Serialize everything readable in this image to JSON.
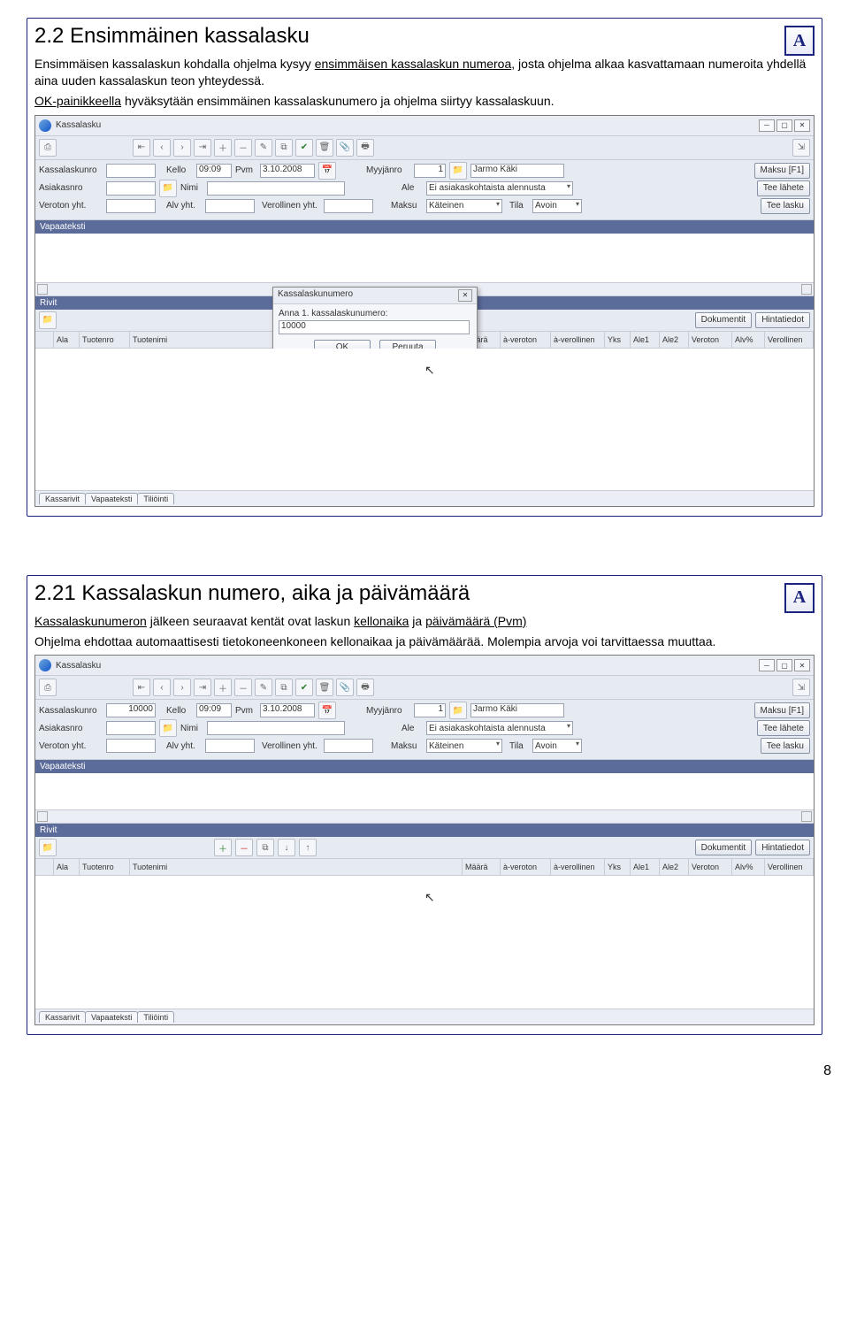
{
  "section1": {
    "heading": "2.2 Ensimmäinen kassalasku",
    "p1a": "Ensimmäisen kassalaskun kohdalla ohjelma kysyy ",
    "p1b": "ensimmäisen kassalaskun numeroa",
    "p1c": ", josta ohjelma alkaa kasvattamaan numeroita yhdellä aina uuden kassalaskun teon yhteydessä.",
    "p2a": "OK-painikkeella",
    "p2b": " hyväksytään ensimmäinen kassalaskunumero ja ohjelma siirtyy kassalaskuun."
  },
  "section2": {
    "heading": "2.21 Kassalaskun numero, aika ja päivämäärä",
    "p1a": "Kassalaskunumeron",
    "p1b": " jälkeen seuraavat kentät ovat laskun ",
    "p1c": "kellonaika",
    "p1d": " ja ",
    "p1e": "päivämäärä (Pvm)",
    "p2": "Ohjelma ehdottaa automaattisesti tietokoneenkoneen kellonaikaa ja päivämäärää. Molempia arvoja voi tarvittaessa muuttaa."
  },
  "win": {
    "title": "Kassalasku",
    "labels": {
      "kassanro": "Kassalaskunro",
      "kello": "Kello",
      "pvm": "Pvm",
      "myyjanro": "Myyjänro",
      "asiakasnro": "Asiakasnro",
      "nimi": "Nimi",
      "ale": "Ale",
      "veroton": "Veroton yht.",
      "alv": "Alv yht.",
      "verollinen": "Verollinen yht.",
      "maksu": "Maksu",
      "tila": "Tila"
    },
    "vals": {
      "kello": "09:09",
      "pvm": "3.10.2008",
      "myyjanro": "1",
      "myyjanimi": "Jarmo Käki",
      "ale": "Ei asiakaskohtaista alennusta",
      "maksu": "Käteinen",
      "tila": "Avoin",
      "kassanro2": "10000"
    },
    "buttons": {
      "maksuf1": "Maksu [F1]",
      "teelahete": "Tee lähete",
      "teelasku": "Tee lasku",
      "dokumentit": "Dokumentit",
      "hintatiedot": "Hintatiedot"
    },
    "bars": {
      "vapaa": "Vapaateksti",
      "rivit": "Rivit"
    },
    "grid": [
      "Ala",
      "Tuotenro",
      "Tuotenimi",
      "Määrä",
      "à-veroton",
      "à-verollinen",
      "Yks",
      "Ale1",
      "Ale2",
      "Veroton",
      "Alv%",
      "Verollinen"
    ],
    "tabs": [
      "Kassarivit",
      "Vapaateksti",
      "Tiliöinti"
    ]
  },
  "dialog": {
    "title": "Kassalaskunumero",
    "label": "Anna 1. kassalaskunumero:",
    "value": "10000",
    "ok": "OK",
    "cancel": "Peruuta"
  },
  "page": "8"
}
